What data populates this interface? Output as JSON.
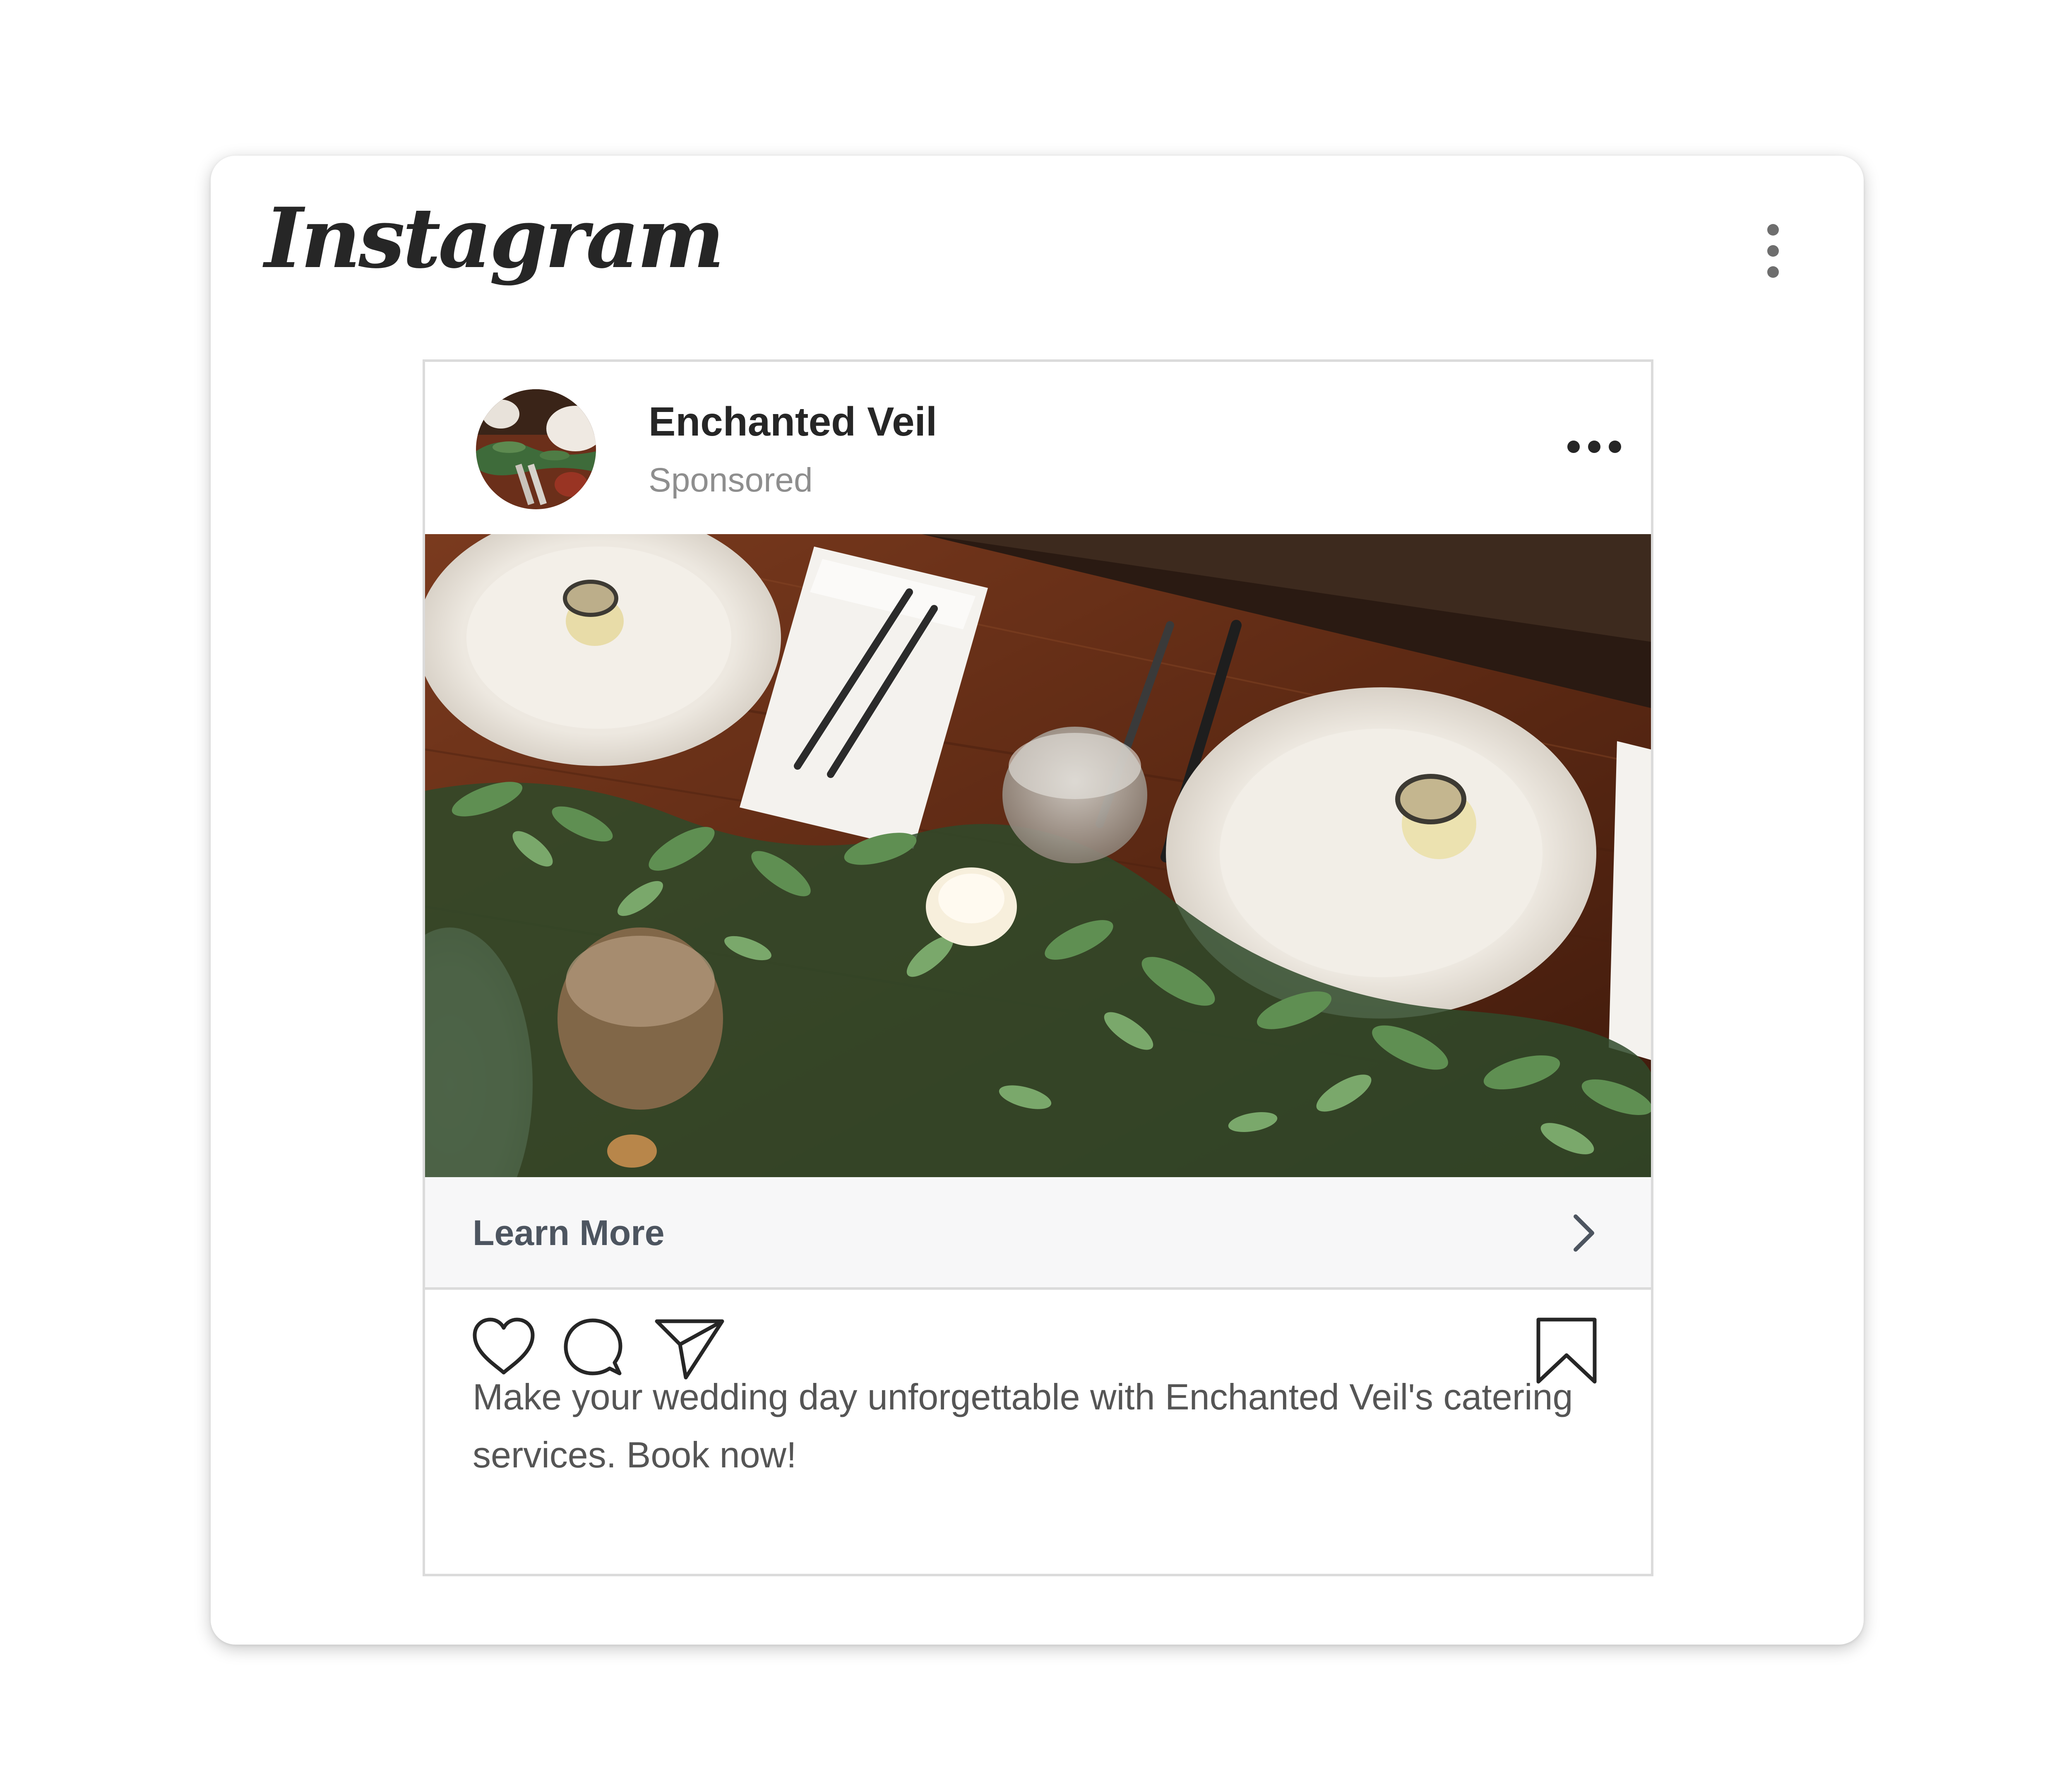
{
  "app": {
    "logo_text": "Instagram",
    "menu_icon": "vertical-dots-icon"
  },
  "post": {
    "account_name": "Enchanted Veil",
    "sponsored_label": "Sponsored",
    "menu_icon": "horizontal-dots-icon",
    "image_description_icon": "table-setting-photo",
    "cta": {
      "label": "Learn More",
      "icon": "chevron-right-icon"
    },
    "actions": {
      "like_icon": "heart-icon",
      "comment_icon": "comment-icon",
      "share_icon": "paper-plane-icon",
      "save_icon": "bookmark-icon"
    },
    "caption": "Make your wedding day unforgettable with Enchanted Veil's catering services. Book now!"
  },
  "colors": {
    "text_primary": "#262626",
    "text_secondary": "#8e8e8e",
    "cta_background": "#f7f7f8",
    "border": "#dbdbdb"
  }
}
